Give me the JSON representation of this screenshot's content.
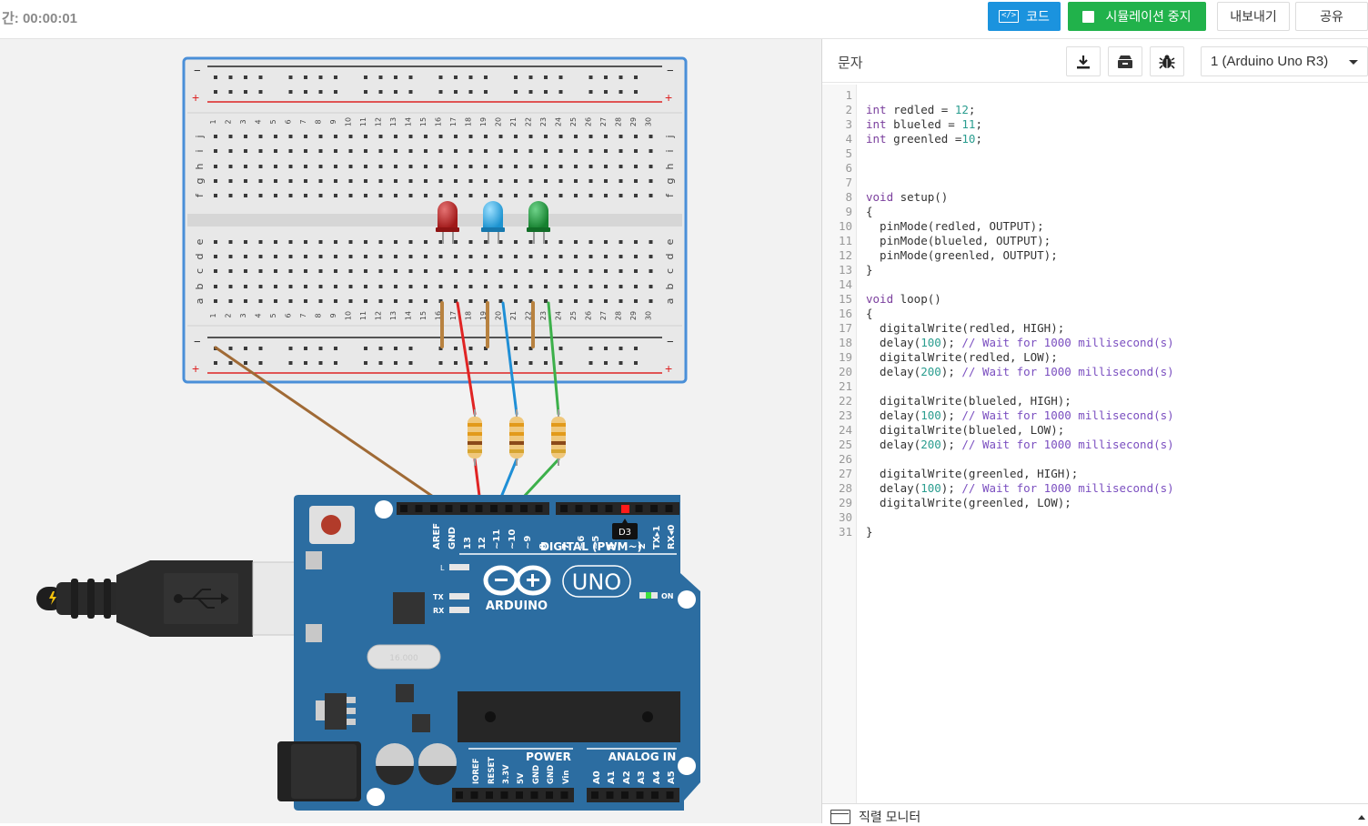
{
  "toolbar": {
    "timer": "간: 00:00:01",
    "code_label": "코드",
    "simulation_label": "시뮬레이션 중지",
    "export_label": "내보내기",
    "share_label": "공유"
  },
  "colors": {
    "code_button": "#1b93de",
    "simulation_button": "#21b24b",
    "arduino_board": "#2c6da1",
    "red_led": "#b01c1c",
    "blue_led": "#2ea9e6",
    "green_led": "#1f9a3a",
    "wire_ground": "#a06a35",
    "wire_red": "#e02424",
    "wire_blue": "#1f8fd6",
    "wire_green": "#3cb04a"
  },
  "panel": {
    "mode_label": "문자",
    "device": "1 (Arduino Uno R3)",
    "icons": [
      "download-icon",
      "library-icon",
      "debug-bug-icon"
    ]
  },
  "breadboard": {
    "column_numbers": [
      "1",
      "2",
      "3",
      "4",
      "5",
      "6",
      "7",
      "8",
      "9",
      "10",
      "11",
      "12",
      "13",
      "14",
      "15",
      "16",
      "17",
      "18",
      "19",
      "20",
      "21",
      "22",
      "23",
      "24",
      "25",
      "26",
      "27",
      "28",
      "29",
      "30"
    ],
    "upper_row_letters": [
      "j",
      "i",
      "h",
      "g",
      "f"
    ],
    "lower_row_letters": [
      "e",
      "d",
      "c",
      "b",
      "a"
    ],
    "rail_minus": "−",
    "rail_plus": "+"
  },
  "arduino": {
    "brand": "ARDUINO",
    "model": "UNO",
    "digital_label": "DIGITAL (PWM~)",
    "power_label": "POWER",
    "analog_label": "ANALOG IN",
    "on_label": "ON",
    "tx_label": "TX",
    "rx_label": "RX",
    "l_label": "L",
    "tooltip_pin": "D3",
    "crystal_label": "16.000",
    "digital_pins": [
      "AREF",
      "GND",
      "13",
      "12",
      "~11",
      "~10",
      "~9",
      "8",
      "7",
      "~6",
      "~5",
      "4",
      "~3",
      "2",
      "TX▸1",
      "RX◂0"
    ],
    "power_pins": [
      "IOREF",
      "RESET",
      "3.3V",
      "5V",
      "GND",
      "GND",
      "Vin"
    ],
    "analog_pins": [
      "A0",
      "A1",
      "A2",
      "A3",
      "A4",
      "A5"
    ]
  },
  "code": {
    "lines": [
      "",
      "int redled = 12;",
      "int blueled = 11;",
      "int greenled =10;",
      "",
      "",
      "",
      "void setup()",
      "{",
      "  pinMode(redled, OUTPUT);",
      "  pinMode(blueled, OUTPUT);",
      "  pinMode(greenled, OUTPUT);",
      "}",
      "",
      "void loop()",
      "{",
      "  digitalWrite(redled, HIGH);",
      "  delay(100); // Wait for 1000 millisecond(s)",
      "  digitalWrite(redled, LOW);",
      "  delay(200); // Wait for 1000 millisecond(s)",
      "",
      "  digitalWrite(blueled, HIGH);",
      "  delay(100); // Wait for 1000 millisecond(s)",
      "  digitalWrite(blueled, LOW);",
      "  delay(200); // Wait for 1000 millisecond(s)",
      "",
      "  digitalWrite(greenled, HIGH);",
      "  delay(100); // Wait for 1000 millisecond(s)",
      "  digitalWrite(greenled, LOW);",
      "",
      "}"
    ]
  },
  "serial_monitor": {
    "label": "직렬 모니터"
  }
}
